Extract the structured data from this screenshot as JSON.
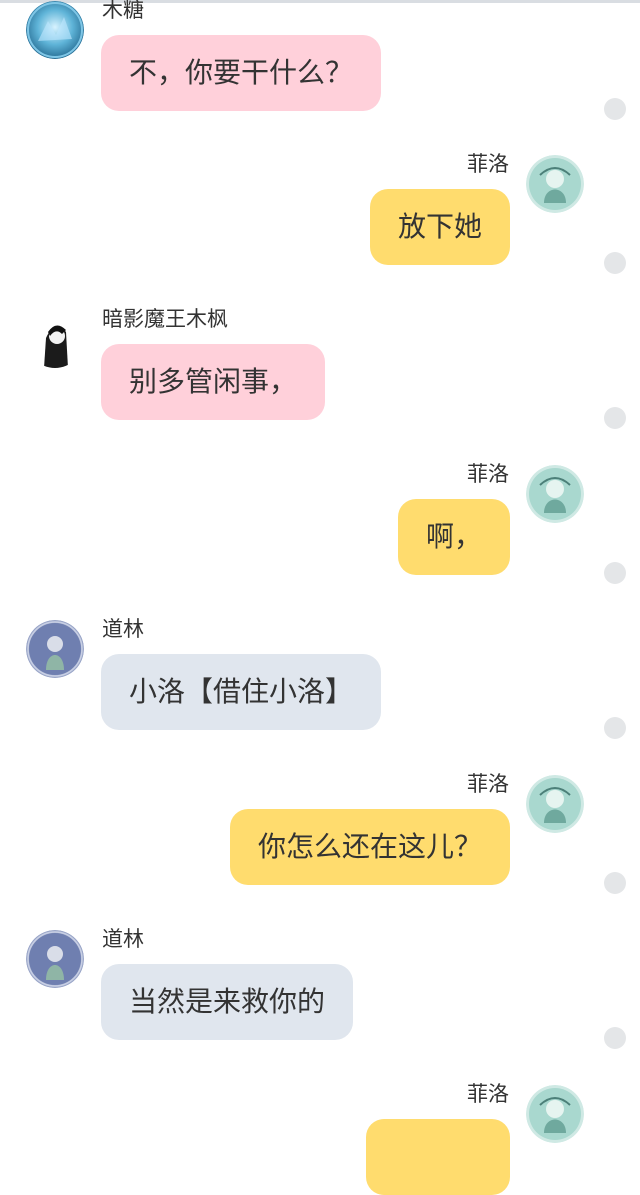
{
  "messages": [
    {
      "side": "left",
      "name": "木糖",
      "text": "不，你要干什么？",
      "bubble_color": "#ffd0da",
      "avatar": "blue-crystal-avatar"
    },
    {
      "side": "right",
      "name": "菲洛",
      "text": "放下她",
      "bubble_color": "#ffdc6e",
      "avatar": "teal-character-avatar"
    },
    {
      "side": "left",
      "name": "暗影魔王木枫",
      "text": "别多管闲事，",
      "bubble_color": "#ffd0da",
      "avatar": "dark-figure-avatar"
    },
    {
      "side": "right",
      "name": "菲洛",
      "text": "啊，",
      "bubble_color": "#ffdc6e",
      "avatar": "teal-character-avatar"
    },
    {
      "side": "left",
      "name": "道林",
      "text": "小洛【借住小洛】",
      "bubble_color": "#e0e6ee",
      "avatar": "purple-character-avatar"
    },
    {
      "side": "right",
      "name": "菲洛",
      "text": "你怎么还在这儿？",
      "bubble_color": "#ffdc6e",
      "avatar": "teal-character-avatar"
    },
    {
      "side": "left",
      "name": "道林",
      "text": "当然是来救你的",
      "bubble_color": "#e0e6ee",
      "avatar": "purple-character-avatar"
    },
    {
      "side": "right",
      "name": "菲洛",
      "text": "",
      "bubble_color": "#ffdc6e",
      "avatar": "teal-character-avatar"
    }
  ]
}
